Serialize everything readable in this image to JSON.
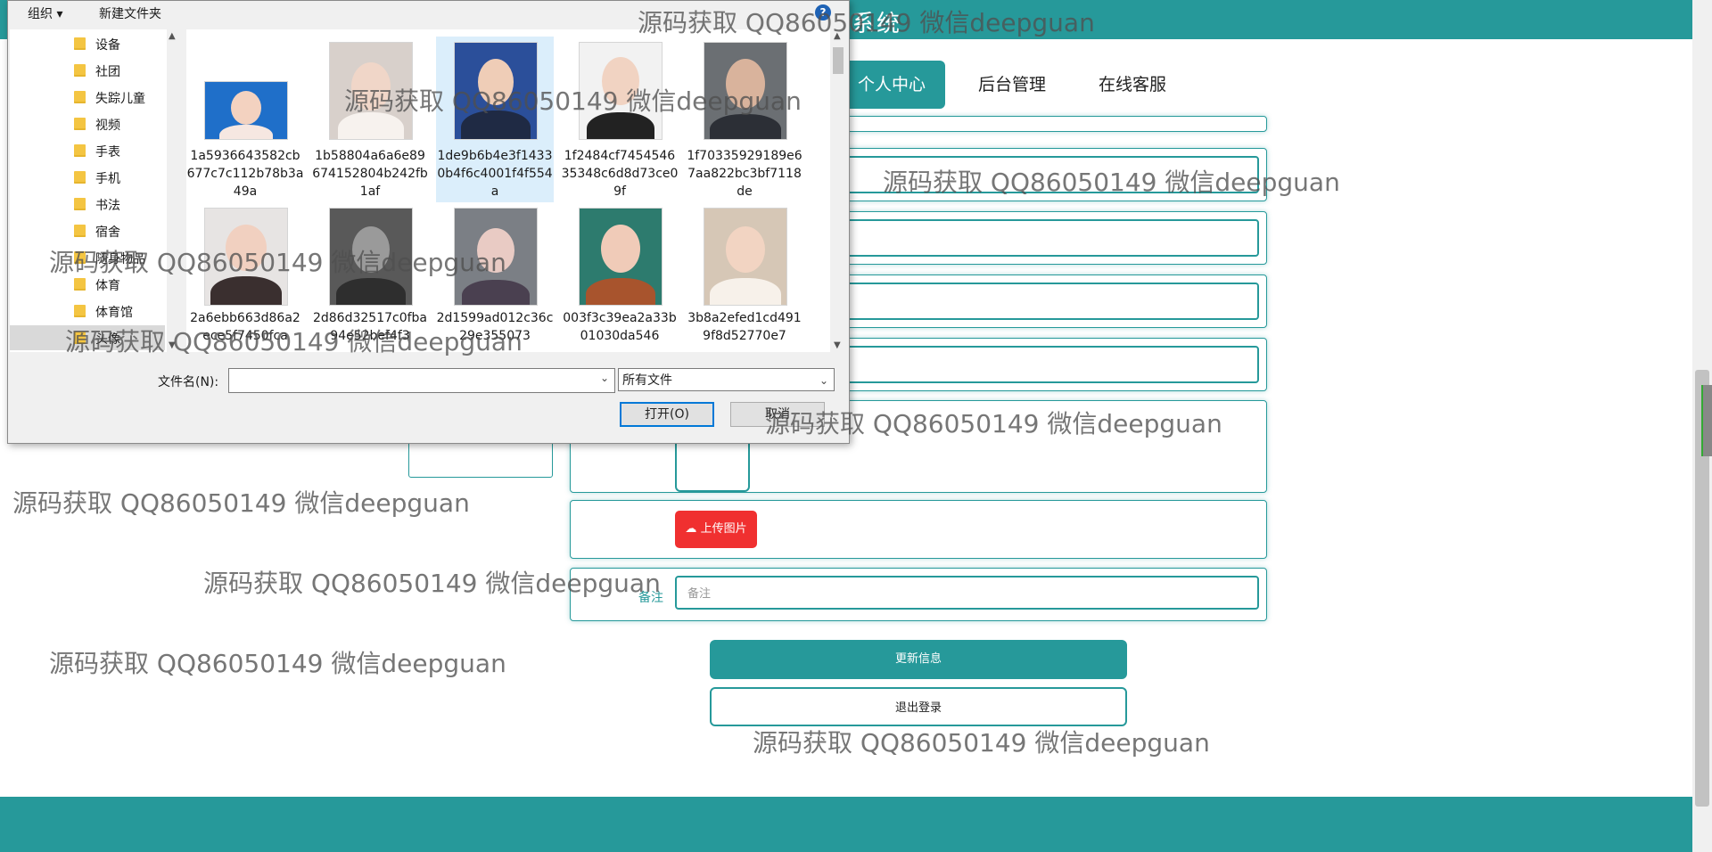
{
  "site": {
    "title": "系统",
    "nav": [
      "个人中心",
      "后台管理",
      "在线客服"
    ],
    "upload_label": "上传图片",
    "remark_label": "备注",
    "remark_placeholder": "备注",
    "update_button": "更新信息",
    "logout_button": "退出登录"
  },
  "dialog": {
    "toolbar": {
      "organize": "组织 ▾",
      "new_folder": "新建文件夹",
      "help": "?"
    },
    "tree": [
      "设备",
      "社团",
      "失踪儿童",
      "视频",
      "手表",
      "手机",
      "书法",
      "宿舍",
      "随身物品",
      "体育",
      "体育馆",
      "头像"
    ],
    "tree_selected": "头像",
    "files": [
      "1a5936643582cb677c7c112b78b3a49a",
      "1b58804a6a6e89674152804b242fb1af",
      "1de9b6b4e3f14330b4f6c4001f4f554a",
      "1f2484cf745454635348c6d8d73ce09f",
      "1f70335929189e67aa822bc3bf7118de",
      "2a6ebb663d86a2ece5f7450fca",
      "2d86d32517c0fba94e52bef4f3",
      "2d1599ad012c36c29e355073",
      "003f3c39ea2a33b01030da546",
      "3b8a2efed1cd4919f8d52770e7"
    ],
    "selected_file": "1de9b6b4e3f14330b4f6c4001f4f554a",
    "filename_label": "文件名(N):",
    "filename_value": "",
    "filetype": "所有文件",
    "open_button": "打开(O)",
    "cancel_button": "取消"
  },
  "watermark": "源码获取 QQ86050149 微信deepguan",
  "colors": {
    "accent": "#26999a",
    "upload": "#f03030",
    "dialog_select": "#dbeefb"
  }
}
